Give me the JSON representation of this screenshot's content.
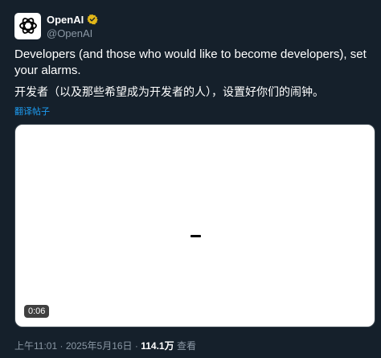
{
  "author": {
    "name": "OpenAI",
    "handle": "@OpenAI",
    "avatar_icon": "openai-logo-icon",
    "verified_icon": "verified-badge-icon",
    "verified_color": "#e2b719"
  },
  "tweet": {
    "text_en": "Developers (and those who would like to become developers), set your alarms.",
    "text_zh": "开发者（以及那些希望成为开发者的人），设置好你们的闹钟。",
    "translate_label": "翻译帖子"
  },
  "media": {
    "type": "video",
    "duration": "0:06"
  },
  "meta": {
    "time": "上午11:01",
    "separator": "·",
    "date": "2025年5月16日",
    "views_count": "114.1万",
    "views_label": "查看"
  },
  "colors": {
    "background": "#15202b",
    "link": "#1d9bf0",
    "secondary_text": "#8b98a5"
  }
}
